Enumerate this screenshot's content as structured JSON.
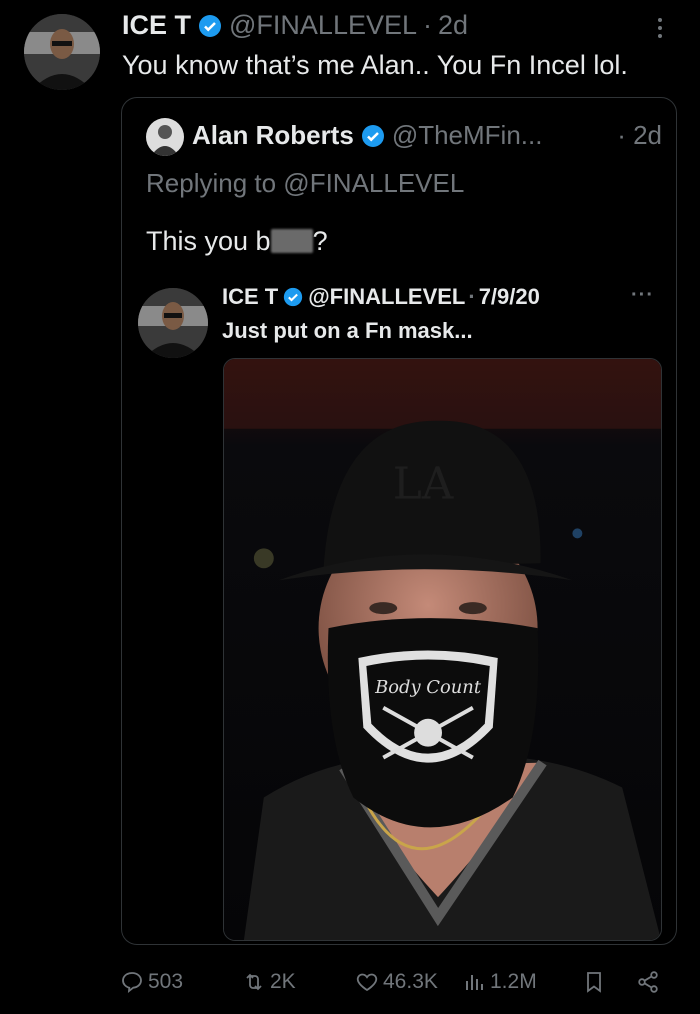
{
  "tweet": {
    "author_name": "ICE T",
    "handle": "@FINALLEVEL",
    "time": "2d",
    "text": "You know that’s me Alan.. You Fn Incel lol."
  },
  "quote": {
    "author_name": "Alan Roberts",
    "handle": "@TheMFin...",
    "time": "2d",
    "replying_to": "Replying to @FINALLEVEL",
    "text_start": "This you b",
    "text_end": "?"
  },
  "nested": {
    "author_name": "ICE T",
    "handle": "@FINALLEVEL",
    "date": "7/9/20",
    "text": "Just put on a Fn mask...",
    "mask_text": "Body Count"
  },
  "actions": {
    "replies": "503",
    "reposts": "2K",
    "likes": "46.3K",
    "views": "1.2M"
  },
  "colors": {
    "background": "#000000",
    "text_primary": "#e7e9ea",
    "text_secondary": "#71767b",
    "verified": "#1d9bf0"
  }
}
